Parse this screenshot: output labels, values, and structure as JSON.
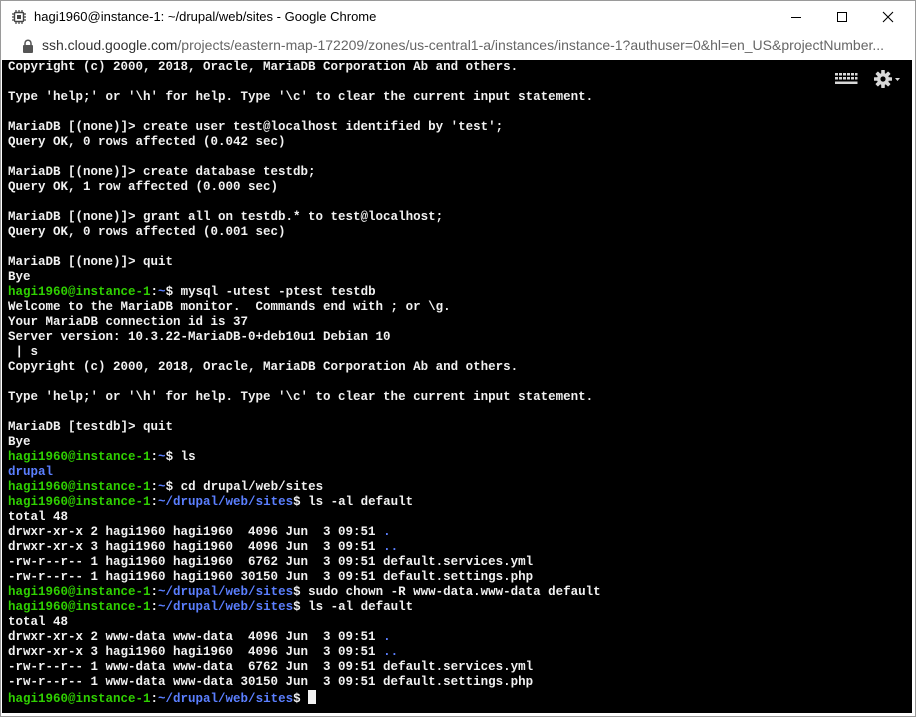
{
  "window": {
    "title": "hagi1960@instance-1: ~/drupal/web/sites - Google Chrome",
    "app_icon": "chip-icon",
    "controls": {
      "minimize": "minimize-icon",
      "maximize": "maximize-icon",
      "close": "close-icon"
    }
  },
  "address": {
    "host": "ssh.cloud.google.com",
    "path": "/projects/eastern-map-172209/zones/us-central1-a/instances/instance-1?authuser=0&hl=en_US&projectNumber..."
  },
  "toolbar_icons": {
    "keyboard": "keyboard-icon",
    "settings": "gear-icon"
  },
  "colors": {
    "prompt_user": "#2fd000",
    "prompt_path": "#5b7fff",
    "text": "#f2f2f2",
    "background": "#000000"
  },
  "terminal": {
    "lines": [
      {
        "text": "Copyright (c) 2000, 2018, Oracle, MariaDB Corporation Ab and others."
      },
      {
        "text": ""
      },
      {
        "text": "Type 'help;' or '\\h' for help. Type '\\c' to clear the current input statement."
      },
      {
        "text": ""
      },
      {
        "text": "MariaDB [(none)]> create user test@localhost identified by 'test';"
      },
      {
        "text": "Query OK, 0 rows affected (0.042 sec)"
      },
      {
        "text": ""
      },
      {
        "text": "MariaDB [(none)]> create database testdb;"
      },
      {
        "text": "Query OK, 1 row affected (0.000 sec)"
      },
      {
        "text": ""
      },
      {
        "text": "MariaDB [(none)]> grant all on testdb.* to test@localhost;"
      },
      {
        "text": "Query OK, 0 rows affected (0.001 sec)"
      },
      {
        "text": ""
      },
      {
        "text": "MariaDB [(none)]> quit"
      },
      {
        "text": "Bye"
      },
      {
        "user": "hagi1960@instance-1",
        "sep": ":",
        "path": "~",
        "cmd": "$ mysql -utest -ptest testdb"
      },
      {
        "text": "Welcome to the MariaDB monitor.  Commands end with ; or \\g."
      },
      {
        "text": "Your MariaDB connection id is 37"
      },
      {
        "text": "Server version: 10.3.22-MariaDB-0+deb10u1 Debian 10"
      },
      {
        "text": " | s"
      },
      {
        "text": "Copyright (c) 2000, 2018, Oracle, MariaDB Corporation Ab and others."
      },
      {
        "text": ""
      },
      {
        "text": "Type 'help;' or '\\h' for help. Type '\\c' to clear the current input statement."
      },
      {
        "text": ""
      },
      {
        "text": "MariaDB [testdb]> quit"
      },
      {
        "text": "Bye"
      },
      {
        "user": "hagi1960@instance-1",
        "sep": ":",
        "path": "~",
        "cmd": "$ ls"
      },
      {
        "dir": "drupal"
      },
      {
        "user": "hagi1960@instance-1",
        "sep": ":",
        "path": "~",
        "cmd": "$ cd drupal/web/sites"
      },
      {
        "user": "hagi1960@instance-1",
        "sep": ":",
        "path": "~/drupal/web/sites",
        "cmd": "$ ls -al default"
      },
      {
        "text": "total 48"
      },
      {
        "text": "drwxr-xr-x 2 hagi1960 hagi1960  4096 Jun  3 09:51 ",
        "dir": "."
      },
      {
        "text": "drwxr-xr-x 3 hagi1960 hagi1960  4096 Jun  3 09:51 ",
        "dir": ".."
      },
      {
        "text": "-rw-r--r-- 1 hagi1960 hagi1960  6762 Jun  3 09:51 default.services.yml"
      },
      {
        "text": "-rw-r--r-- 1 hagi1960 hagi1960 30150 Jun  3 09:51 default.settings.php"
      },
      {
        "user": "hagi1960@instance-1",
        "sep": ":",
        "path": "~/drupal/web/sites",
        "cmd": "$ sudo chown -R www-data.www-data default"
      },
      {
        "user": "hagi1960@instance-1",
        "sep": ":",
        "path": "~/drupal/web/sites",
        "cmd": "$ ls -al default"
      },
      {
        "text": "total 48"
      },
      {
        "text": "drwxr-xr-x 2 www-data www-data  4096 Jun  3 09:51 ",
        "dir": "."
      },
      {
        "text": "drwxr-xr-x 3 hagi1960 hagi1960  4096 Jun  3 09:51 ",
        "dir": ".."
      },
      {
        "text": "-rw-r--r-- 1 www-data www-data  6762 Jun  3 09:51 default.services.yml"
      },
      {
        "text": "-rw-r--r-- 1 www-data www-data 30150 Jun  3 09:51 default.settings.php"
      },
      {
        "user": "hagi1960@instance-1",
        "sep": ":",
        "path": "~/drupal/web/sites",
        "cmd": "$ ",
        "cursor": true
      }
    ]
  }
}
